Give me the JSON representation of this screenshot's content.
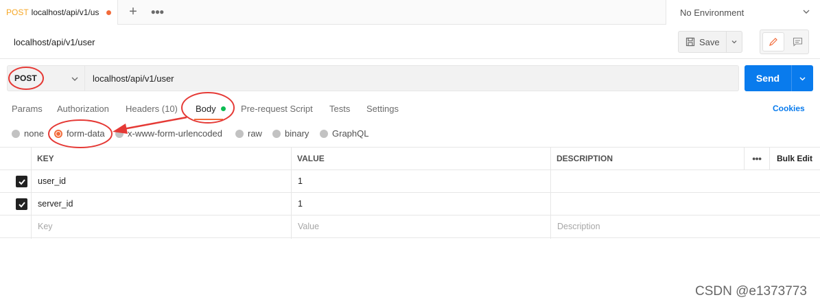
{
  "tab": {
    "method": "POST",
    "url": "localhost/api/v1/us",
    "unsaved_color": "#f26b3a"
  },
  "tabbar": {
    "new_tab_icon": "plus-icon",
    "more_icon": "ellipsis-icon"
  },
  "environment": {
    "label": "No Environment"
  },
  "request": {
    "title": "localhost/api/v1/user",
    "method": "POST",
    "url": "localhost/api/v1/user",
    "save_label": "Save",
    "send_label": "Send"
  },
  "request_tabs": {
    "params": "Params",
    "authorization": "Authorization",
    "headers": "Headers",
    "headers_count": "(10)",
    "body": "Body",
    "prerequest": "Pre-request Script",
    "tests": "Tests",
    "settings": "Settings",
    "cookies": "Cookies"
  },
  "body_types": {
    "none": "none",
    "form_data": "form-data",
    "urlencoded": "x-www-form-urlencoded",
    "raw": "raw",
    "binary": "binary",
    "graphql": "GraphQL",
    "selected": "form-data"
  },
  "table": {
    "headers": {
      "key": "KEY",
      "value": "VALUE",
      "description": "DESCRIPTION",
      "bulk_edit": "Bulk Edit"
    },
    "rows": [
      {
        "checked": true,
        "key": "user_id",
        "value": "1"
      },
      {
        "checked": true,
        "key": "server_id",
        "value": "1"
      }
    ],
    "placeholders": {
      "key": "Key",
      "value": "Value",
      "description": "Description"
    }
  },
  "colors": {
    "accent": "#f26b3a",
    "send": "#097bed",
    "annotation": "#e53935",
    "body_dot": "#0cbb52"
  },
  "watermark": "CSDN @e1373773"
}
